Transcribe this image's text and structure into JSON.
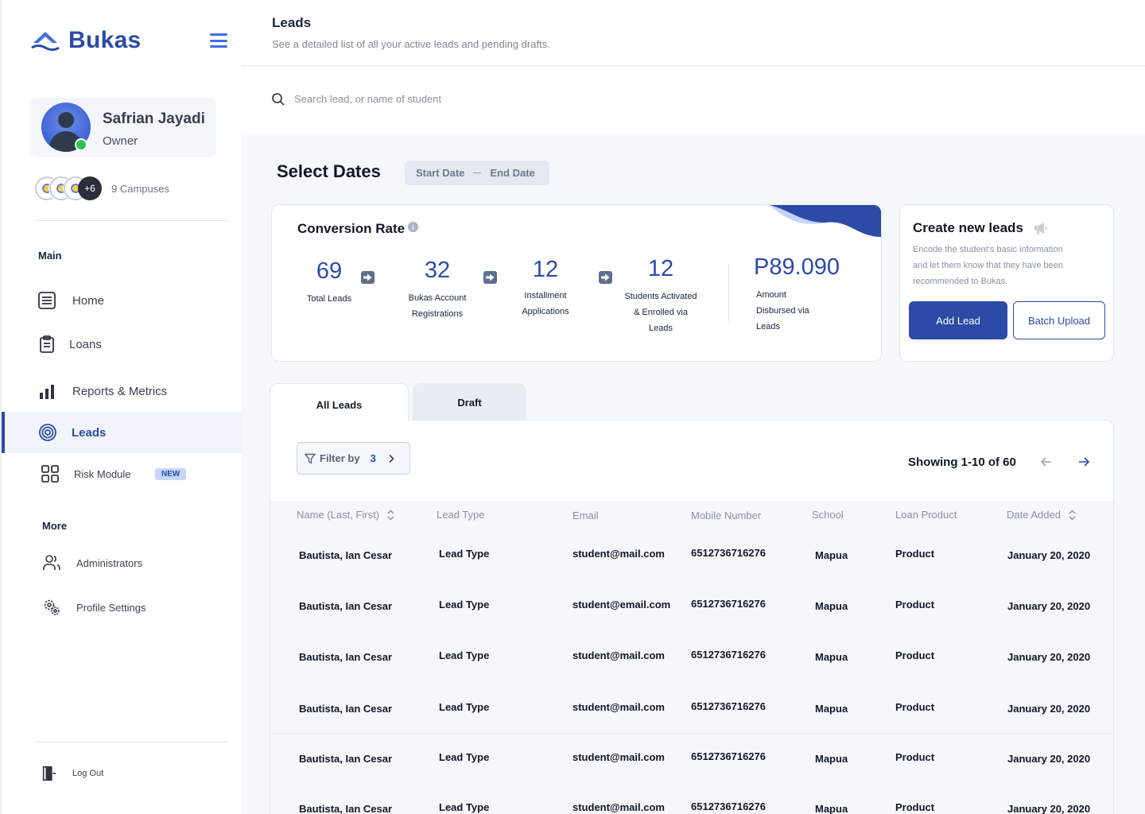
{
  "brand": {
    "name": "Bukas",
    "color": "#2b4ba6",
    "logo_icon": "mountain-logo-icon"
  },
  "profile": {
    "name": "Safrian Jayadi",
    "role": "Owner",
    "status": "online"
  },
  "campuses": {
    "extra_count": "+6",
    "label": "9 Campuses"
  },
  "nav": {
    "main_label": "Main",
    "more_label": "More",
    "items": [
      {
        "label": "Home",
        "icon": "home-list-icon"
      },
      {
        "label": "Loans",
        "icon": "clipboard-icon"
      },
      {
        "label": "Reports & Metrics",
        "icon": "bar-chart-icon"
      },
      {
        "label": "Leads",
        "icon": "target-icon",
        "active": true
      },
      {
        "label": "Risk Module",
        "icon": "grid-icon",
        "badge": "NEW"
      }
    ],
    "more_items": [
      {
        "label": "Administrators",
        "icon": "users-icon"
      },
      {
        "label": "Profile Settings",
        "icon": "gears-icon"
      }
    ],
    "logout": "Log Out"
  },
  "header": {
    "title": "Leads",
    "subtitle": "See a detailed list of all your active leads and pending drafts."
  },
  "search": {
    "placeholder": "Search lead, or name of student",
    "value": ""
  },
  "dates": {
    "title": "Select Dates",
    "start": "Start Date",
    "end": "End Date"
  },
  "conversion": {
    "title": "Conversion Rate",
    "metrics": [
      {
        "value": "69",
        "label_lines": [
          "Total Leads"
        ]
      },
      {
        "value": "32",
        "label_lines": [
          "Bukas Account",
          "Registrations"
        ]
      },
      {
        "value": "12",
        "label_lines": [
          "Installment",
          "Applications"
        ]
      },
      {
        "value": "12",
        "label_lines": [
          "Students Activated",
          "& Enrolled via",
          "Leads"
        ]
      },
      {
        "value": "P89.090",
        "label_lines": [
          "Amount",
          "Disbursed via",
          "Leads"
        ]
      }
    ]
  },
  "create": {
    "title": "Create new leads",
    "desc_lines": [
      "Encode the student's basic information",
      "and let them know that they have been",
      "recommended to Bukas."
    ],
    "add_label": "Add Lead",
    "batch_label": "Batch Upload"
  },
  "tabs": {
    "all": "All Leads",
    "draft": "Draft"
  },
  "table": {
    "filter_label": "Filter by",
    "filter_count": "3",
    "showing": "Showing 1-10 of 60",
    "columns": [
      "Name (Last, First)",
      "Lead Type",
      "Email",
      "Mobile Number",
      "School",
      "Loan Product",
      "Date Added"
    ],
    "rows": [
      [
        "Bautista, Ian Cesar",
        "Lead Type",
        "student@mail.com",
        "6512736716276",
        "Mapua",
        "Product",
        "January 20, 2020"
      ],
      [
        "Bautista, Ian Cesar",
        "Lead Type",
        "student@email.com",
        "6512736716276",
        "Mapua",
        "Product",
        "January 20, 2020"
      ],
      [
        "Bautista, Ian Cesar",
        "Lead Type",
        "student@mail.com",
        "6512736716276",
        "Mapua",
        "Product",
        "January 20, 2020"
      ],
      [
        "Bautista, Ian Cesar",
        "Lead Type",
        "student@mail.com",
        "6512736716276",
        "Mapua",
        "Product",
        "January 20, 2020"
      ],
      [
        "Bautista, Ian Cesar",
        "Lead Type",
        "student@mail.com",
        "6512736716276",
        "Mapua",
        "Product",
        "January 20, 2020"
      ],
      [
        "Bautista, Ian Cesar",
        "Lead Type",
        "student@mail.com",
        "6512736716276",
        "Mapua",
        "Product",
        "January 20, 2020"
      ]
    ]
  }
}
